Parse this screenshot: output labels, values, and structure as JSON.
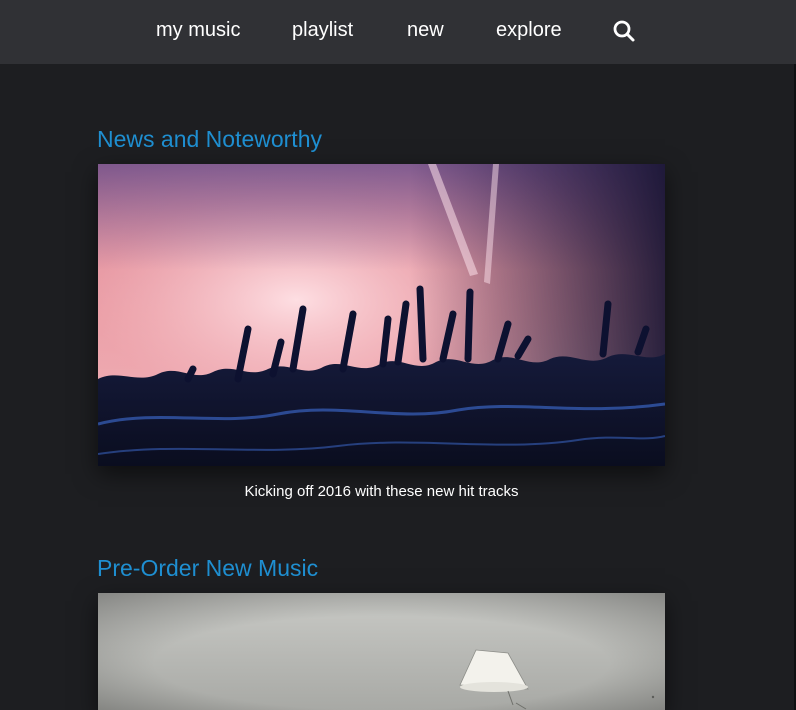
{
  "nav": {
    "items": [
      {
        "label": "my music"
      },
      {
        "label": "playlist"
      },
      {
        "label": "new"
      },
      {
        "label": "explore"
      }
    ],
    "search_icon": "search-icon"
  },
  "sections": [
    {
      "title": "News and Noteworthy",
      "image": "concert-crowd-image",
      "caption": "Kicking off 2016 with these new hit tracks"
    },
    {
      "title": "Pre-Order New Music",
      "image": "floating-lamp-image"
    }
  ],
  "colors": {
    "background": "#1d1e21",
    "navbar": "#303135",
    "accent": "#1f8fd1",
    "text": "#ffffff"
  }
}
